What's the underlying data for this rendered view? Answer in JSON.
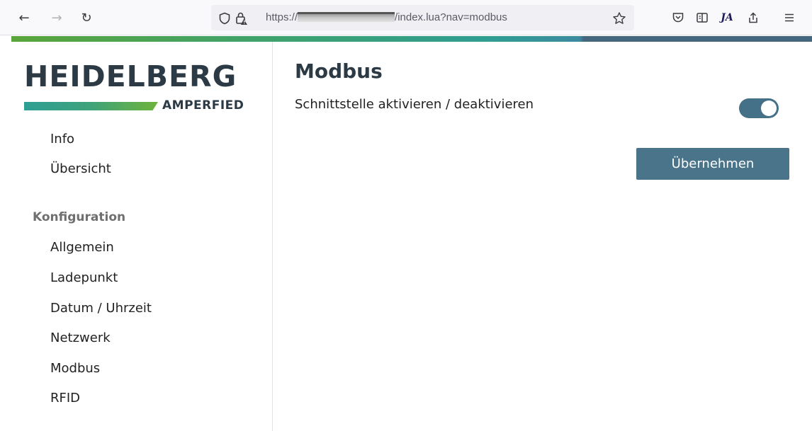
{
  "browser": {
    "url_prefix": "https://",
    "url_path": "/index.lua?nav=modbus",
    "nav": {
      "back": "←",
      "forward": "→",
      "reload": "↻"
    },
    "icons": [
      "shield-icon",
      "lock-icon",
      "bookmark-star-icon",
      "pocket-icon",
      "reader-view-icon",
      "extension-ja-icon",
      "share-icon",
      "menu-icon"
    ],
    "extension_label": "JA"
  },
  "brand": {
    "name": "HEIDELBERG",
    "subname": "AMPERFIED",
    "colors": {
      "dark": "#2b3a44",
      "green": "#5aa53a",
      "teal": "#2f9d93",
      "accent": "#497489"
    }
  },
  "sidebar": {
    "top_items": [
      {
        "label": "Info"
      },
      {
        "label": "Übersicht"
      }
    ],
    "section_title": "Konfiguration",
    "config_items": [
      {
        "label": "Allgemein"
      },
      {
        "label": "Ladepunkt"
      },
      {
        "label": "Datum / Uhrzeit"
      },
      {
        "label": "Netzwerk"
      },
      {
        "label": "Modbus"
      },
      {
        "label": "RFID"
      }
    ]
  },
  "main": {
    "title": "Modbus",
    "setting_label": "Schnittstelle aktivieren / deaktivieren",
    "toggle_on": true,
    "apply_label": "Übernehmen"
  }
}
